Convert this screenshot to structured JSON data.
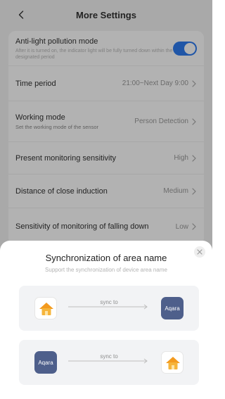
{
  "header": {
    "title": "More Settings"
  },
  "settings": {
    "anti_light": {
      "label": "Anti-light pollution mode",
      "desc": "After it is turned on, the indicator light will be fully turned down within the designated period",
      "enabled": true
    },
    "time_period": {
      "label": "Time period",
      "value": "21:00~Next Day 9:00"
    },
    "working_mode": {
      "label": "Working mode",
      "desc": "Set the working mode of the sensor",
      "value": "Person Detection"
    },
    "present_sensitivity": {
      "label": "Present monitoring sensitivity",
      "value": "High"
    },
    "close_induction": {
      "label": "Distance of close induction",
      "value": "Medium"
    },
    "falling_sensitivity": {
      "label": "Sensitivity of monitoring of falling down",
      "value": "Low"
    }
  },
  "sheet": {
    "title": "Synchronization of area name",
    "subtitle": "Support the synchronization of device area name",
    "options": [
      {
        "from_icon": "home-app-icon",
        "label": "sync to",
        "to_icon": "aqara-app-icon",
        "to_text": "Aqara"
      },
      {
        "from_icon": "aqara-app-icon",
        "from_text": "Aqara",
        "label": "sync to",
        "to_icon": "home-app-icon"
      }
    ]
  },
  "colors": {
    "accent": "#2f7bf0",
    "aqara_icon_bg": "#4e5f8b",
    "home_icon_roof": "#f39a1e"
  }
}
